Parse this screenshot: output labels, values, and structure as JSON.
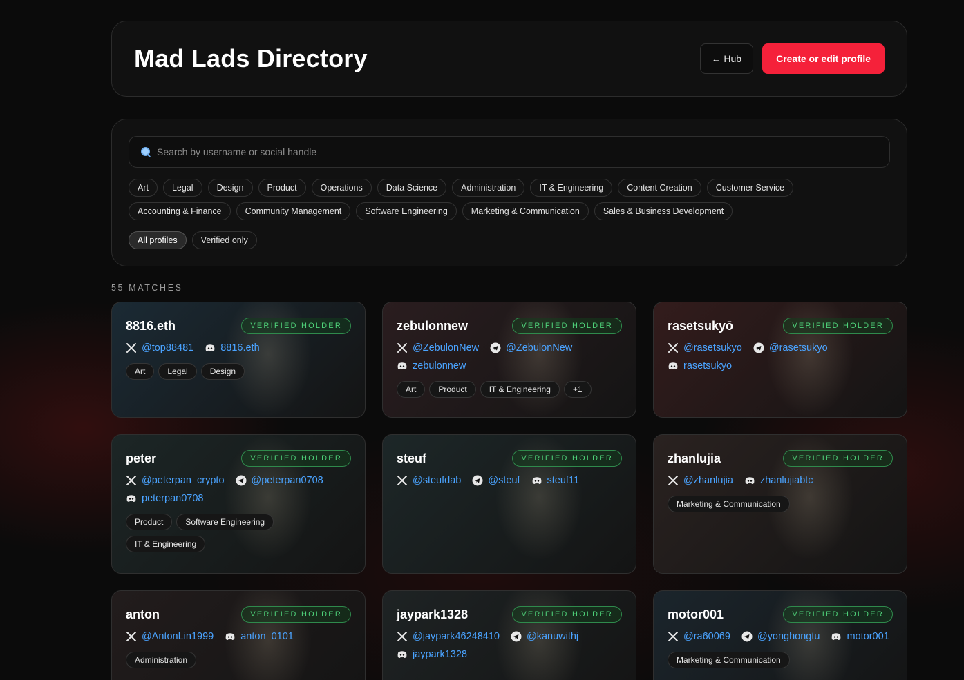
{
  "header": {
    "title": "Mad Lads Directory",
    "hub_label": "← Hub",
    "create_label": "Create or edit profile"
  },
  "search": {
    "placeholder": "Search by username or social handle"
  },
  "categories": [
    "Art",
    "Legal",
    "Design",
    "Product",
    "Operations",
    "Data Science",
    "Administration",
    "IT & Engineering",
    "Content Creation",
    "Customer Service",
    "Accounting & Finance",
    "Community Management",
    "Software Engineering",
    "Marketing & Communication",
    "Sales & Business Development"
  ],
  "toggles": {
    "all": "All profiles",
    "verified": "Verified only"
  },
  "matches_label": "55 MATCHES",
  "badge_label": "VERIFIED HOLDER",
  "colors": {
    "accent": "#f5213a",
    "link": "#4aa3ff",
    "verified": "#4fd27a"
  },
  "cards": [
    {
      "name": "8816.eth",
      "tint": "#1b2a34",
      "socials": [
        {
          "icon": "x-icon",
          "text": "@top88481"
        },
        {
          "icon": "discord-icon",
          "text": "8816.eth"
        }
      ],
      "tags": [
        "Art",
        "Legal",
        "Design"
      ]
    },
    {
      "name": "zebulonnew",
      "tint": "#2a1d1f",
      "socials": [
        {
          "icon": "x-icon",
          "text": "@ZebulonNew"
        },
        {
          "icon": "telegram-icon",
          "text": "@ZebulonNew"
        },
        {
          "icon": "discord-icon",
          "text": "zebulonnew"
        }
      ],
      "tags": [
        "Art",
        "Product",
        "IT & Engineering",
        "+1"
      ]
    },
    {
      "name": "rasetsukyō",
      "tint": "#331c1c",
      "socials": [
        {
          "icon": "x-icon",
          "text": "@rasetsukyo"
        },
        {
          "icon": "telegram-icon",
          "text": "@rasetsukyo"
        },
        {
          "icon": "discord-icon",
          "text": "rasetsukyo"
        }
      ],
      "tags": []
    },
    {
      "name": "peter",
      "tint": "#1c2626",
      "socials": [
        {
          "icon": "x-icon",
          "text": "@peterpan_crypto"
        },
        {
          "icon": "telegram-icon",
          "text": "@peterpan0708"
        },
        {
          "icon": "discord-icon",
          "text": "peterpan0708"
        }
      ],
      "tags": [
        "Product",
        "Software Engineering",
        "IT & Engineering"
      ]
    },
    {
      "name": "steuf",
      "tint": "#1d2728",
      "socials": [
        {
          "icon": "x-icon",
          "text": "@steufdab"
        },
        {
          "icon": "telegram-icon",
          "text": "@steuf"
        },
        {
          "icon": "discord-icon",
          "text": "steuf11"
        }
      ],
      "tags": []
    },
    {
      "name": "zhanlujia",
      "tint": "#2a2220",
      "socials": [
        {
          "icon": "x-icon",
          "text": "@zhanlujia"
        },
        {
          "icon": "discord-icon",
          "text": "zhanlujiabtc"
        }
      ],
      "tags": [
        "Marketing & Communication"
      ]
    },
    {
      "name": "anton",
      "tint": "#221c1c",
      "socials": [
        {
          "icon": "x-icon",
          "text": "@AntonLin1999"
        },
        {
          "icon": "discord-icon",
          "text": "anton_0101"
        }
      ],
      "tags": [
        "Administration"
      ]
    },
    {
      "name": "jaypark1328",
      "tint": "#1e2324",
      "socials": [
        {
          "icon": "x-icon",
          "text": "@jaypark46248410"
        },
        {
          "icon": "telegram-icon",
          "text": "@kanuwithj"
        },
        {
          "icon": "discord-icon",
          "text": "jaypark1328"
        }
      ],
      "tags": []
    },
    {
      "name": "motor001",
      "tint": "#1b252c",
      "socials": [
        {
          "icon": "x-icon",
          "text": "@ra60069"
        },
        {
          "icon": "telegram-icon",
          "text": "@yonghongtu"
        },
        {
          "icon": "discord-icon",
          "text": "motor001"
        }
      ],
      "tags": [
        "Marketing & Communication"
      ]
    }
  ]
}
